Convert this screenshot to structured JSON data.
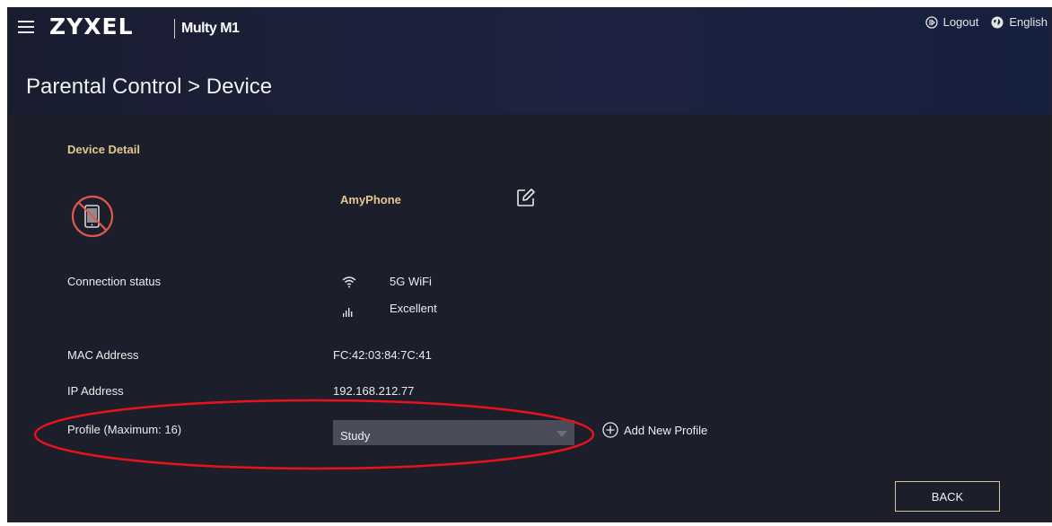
{
  "header": {
    "brand": "ZYXEL",
    "model": "Multy M1",
    "logout_label": "Logout",
    "language_label": "English"
  },
  "page": {
    "title": "Parental Control > Device"
  },
  "device_detail": {
    "section_title": "Device Detail",
    "device_name": "AmyPhone",
    "connection": {
      "label": "Connection status",
      "band": "5G WiFi",
      "signal": "Excellent"
    },
    "mac": {
      "label": "MAC Address",
      "value": "FC:42:03:84:7C:41"
    },
    "ip": {
      "label": "IP Address",
      "value": "192.168.212.77"
    },
    "profile": {
      "label": "Profile (Maximum: 16)",
      "selected": "Study"
    },
    "add_profile_label": "Add New Profile",
    "back_label": "BACK"
  },
  "colors": {
    "accent_gold": "#e4c88d",
    "blocked_red": "#e0584a",
    "annotation_red": "#e8121a"
  },
  "icons": [
    "menu-icon",
    "logout-icon",
    "globe-icon",
    "blocked-phone-icon",
    "edit-icon",
    "wifi-icon",
    "signal-icon",
    "add-circle-icon",
    "dropdown-arrow-icon"
  ]
}
